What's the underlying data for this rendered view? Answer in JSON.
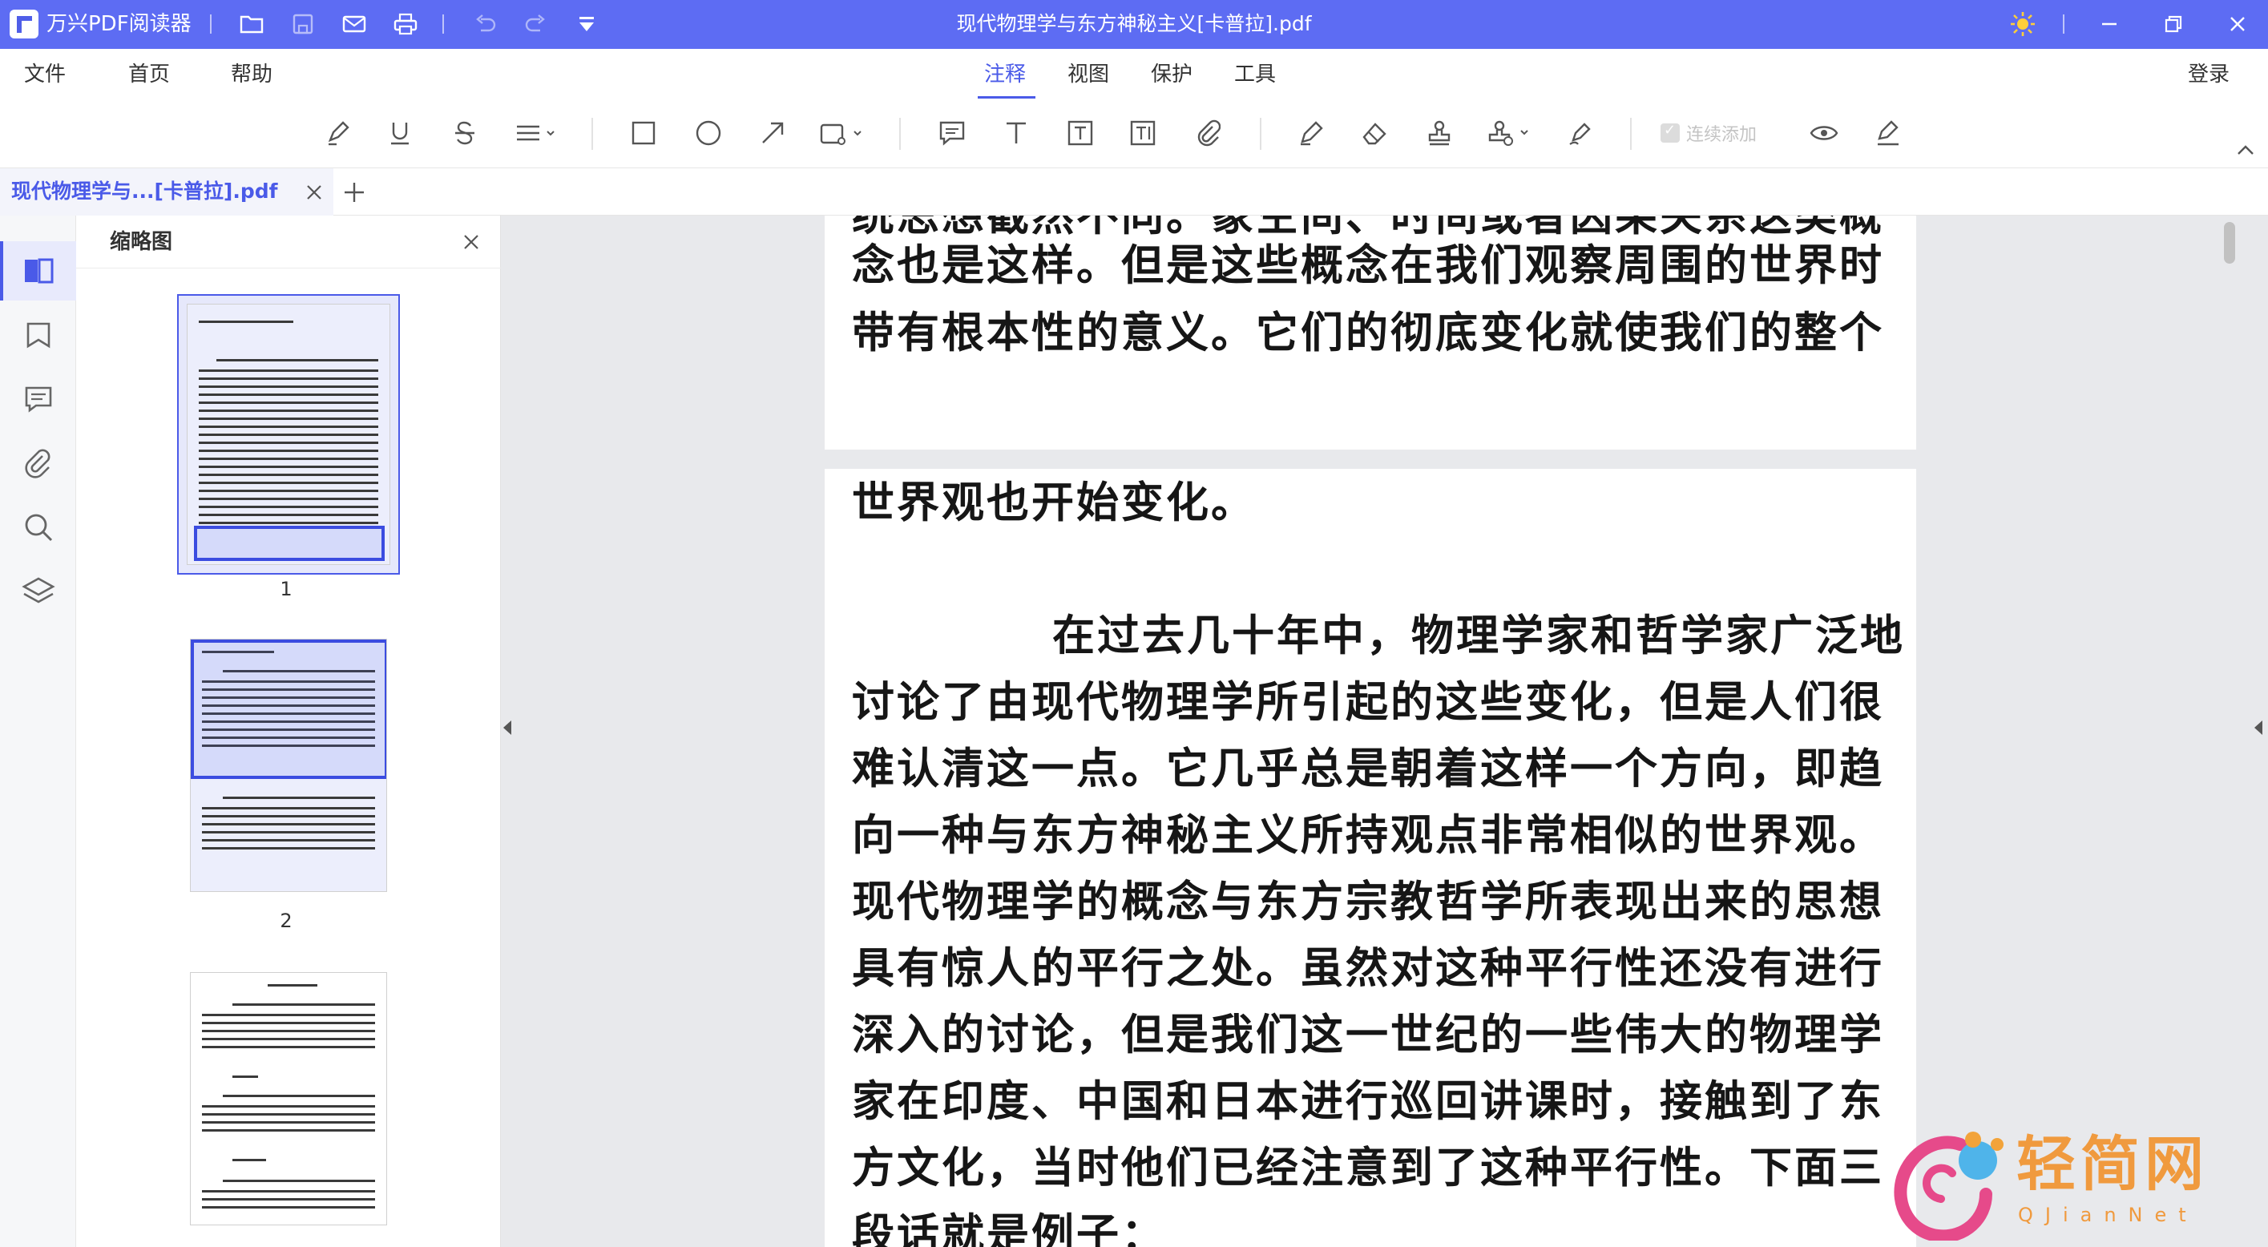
{
  "app": {
    "name": "万兴PDF阅读器",
    "window_title": "现代物理学与东方神秘主义[卡普拉].pdf",
    "brand_color": "#5d6cf3",
    "accent_color": "#4a5ae8"
  },
  "quick_icons": [
    "folder-icon",
    "save-icon",
    "email-icon",
    "print-icon",
    "undo-icon",
    "redo-icon",
    "dropdown-icon"
  ],
  "window_icons": [
    "theme-sun-icon",
    "minimize-icon",
    "restore-icon",
    "close-icon"
  ],
  "menu": {
    "file": "文件",
    "home": "首页",
    "help": "帮助",
    "annotate": "注释",
    "view": "视图",
    "protect": "保护",
    "tools": "工具",
    "login": "登录"
  },
  "toolbar": {
    "continuous_add": "连续添加"
  },
  "tab": {
    "label": "现代物理学与...[卡普拉].pdf"
  },
  "sidebar": {
    "title": "缩略图",
    "rail_icons": [
      "thumbnails-icon",
      "bookmark-icon",
      "comment-icon",
      "attachment-icon",
      "search-icon",
      "layers-icon"
    ],
    "thumbnails": [
      {
        "number": "1"
      },
      {
        "number": "2"
      },
      {
        "number": ""
      }
    ]
  },
  "document": {
    "page1_lines": [
      "统思想截然不同。象空间、时间或者因果关系这类概",
      "念也是这样。但是这些概念在我们观察周围的世界时",
      "带有根本性的意义。它们的彻底变化就使我们的整个"
    ],
    "page2_heading": "世界观也开始变化。",
    "page2_first_line": "在过去几十年中，物理学家和哲学家广泛地",
    "page2_lines": [
      "讨论了由现代物理学所引起的这些变化，但是人们很",
      "难认清这一点。它几乎总是朝着这样一个方向，即趋",
      "向一种与东方神秘主义所持观点非常相似的世界观。",
      "现代物理学的概念与东方宗教哲学所表现出来的思想",
      "具有惊人的平行之处。虽然对这种平行性还没有进行",
      "深入的讨论，但是我们这一世纪的一些伟大的物理学",
      "家在印度、中国和日本进行巡回讲课时，接触到了东",
      "方文化，当时他们已经注意到了这种平行性。下面三",
      "段话就是例子："
    ]
  },
  "watermark": {
    "text": "轻简网",
    "sub": "QJianNet"
  }
}
